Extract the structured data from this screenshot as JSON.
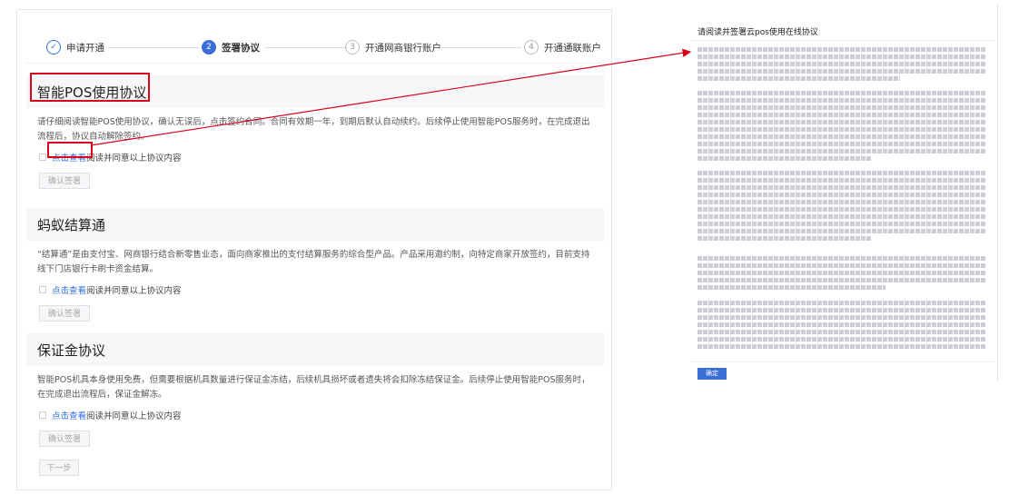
{
  "steps": [
    {
      "num": "",
      "label": "申请开通",
      "state": "done"
    },
    {
      "num": "2",
      "label": "签署协议",
      "state": "active"
    },
    {
      "num": "3",
      "label": "开通网商银行账户",
      "state": "todo"
    },
    {
      "num": "4",
      "label": "开通通联账户",
      "state": "todo"
    }
  ],
  "sections": [
    {
      "title": "智能POS使用协议",
      "desc": "请仔细阅读智能POS使用协议，确认无误后，点击签约合同。合同有效期一年，到期后默认自动续约。后续停止使用智能POS服务时，在完成退出流程后，协议自动解除签约。",
      "link": "点击查看",
      "agree": "阅读并同意以上协议内容",
      "button": "确认签署"
    },
    {
      "title": "蚂蚁结算通",
      "desc": "“结算通”是由支付宝、网商银行结合新零售业态，面向商家推出的支付结算服务的综合型产品。产品采用邀约制，向特定商家开放签约，目前支持线下门店银行卡刷卡资金结算。",
      "link": "点击查看",
      "agree": "阅读并同意以上协议内容",
      "button": "确认签署"
    },
    {
      "title": "保证金协议",
      "desc": "智能POS机具本身使用免费，但需要根据机具数量进行保证金冻结，后续机具损坏或者遗失将会扣除冻结保证金。后续停止使用智能POS服务时，在完成退出流程后，保证金解冻。",
      "link": "点击查看",
      "agree": "阅读并同意以上协议内容",
      "button": "确认签署"
    }
  ],
  "next_button": "下一步",
  "modal": {
    "title": "请阅读并签署云pos使用在线协议",
    "confirm": "确定"
  },
  "colors": {
    "accent": "#3a6fd8",
    "highlight": "#d9001b",
    "link": "#2f6ce0"
  }
}
